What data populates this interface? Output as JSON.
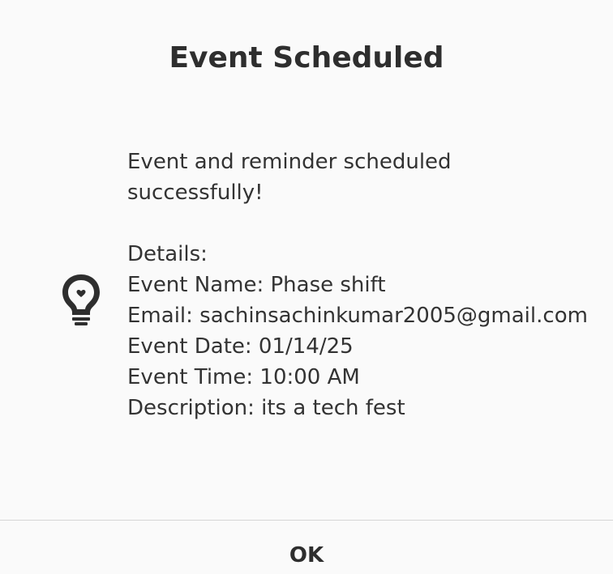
{
  "dialog": {
    "title": "Event Scheduled",
    "icon": "lightbulb-icon",
    "message": {
      "line1": "Event and reminder scheduled",
      "line2": "successfully!",
      "details_label": "Details:",
      "event_name": "Event Name: Phase shift",
      "email": "Email: sachinsachinkumar2005@gmail.com",
      "event_date": "Event Date: 01/14/25",
      "event_time": "Event Time: 10:00 AM",
      "description": "Description: its a tech fest"
    },
    "ok_label": "OK"
  }
}
